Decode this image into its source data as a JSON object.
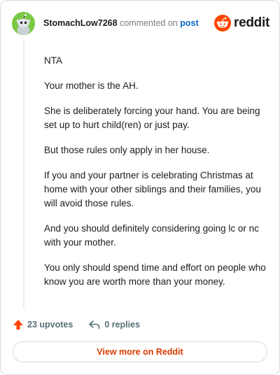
{
  "header": {
    "username": "StomachLow7268",
    "action_text": "commented on",
    "post_link": "post",
    "brand": "reddit",
    "avatar_icon": "snoo-avatar-icon",
    "brand_icon": "reddit-logo-icon"
  },
  "comment": {
    "paragraphs": [
      "NTA",
      "Your mother is the AH.",
      "She is deliberately forcing your hand. You are being set up to hurt child(ren) or just pay.",
      "But those rules only apply in her house.",
      "If you and your partner is celebrating Christmas at home with your other siblings and their families, you will avoid those rules.",
      "And you should definitely considering going lc or nc with your mother.",
      "You only should spend time and effort on people who know you are worth more than your money."
    ]
  },
  "footer": {
    "upvotes_label": "23 upvotes",
    "replies_label": "0 replies",
    "upvote_icon": "upvote-arrow-icon",
    "reply_icon": "reply-arrow-icon"
  },
  "cta": {
    "label": "View more on Reddit"
  },
  "colors": {
    "accent": "#ff4500",
    "link": "#0a66c2",
    "cta_text": "#d93a00",
    "avatar_bg": "#7ac943"
  }
}
